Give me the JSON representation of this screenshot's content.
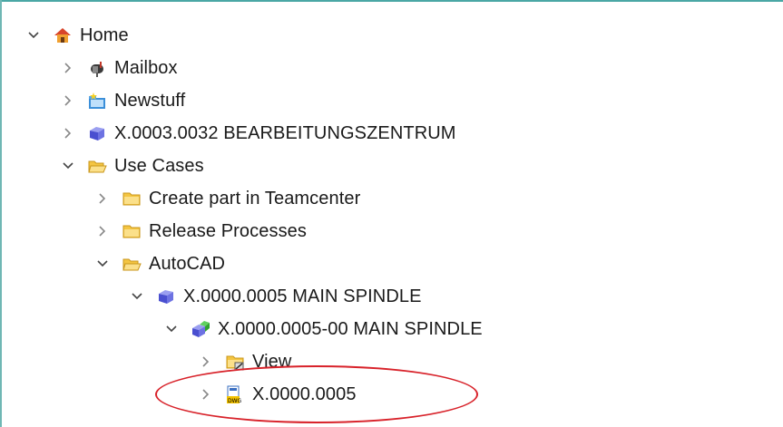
{
  "tree": {
    "items": [
      {
        "label": "Home",
        "icon": "home-icon",
        "expanded": true
      },
      {
        "label": "Mailbox",
        "icon": "mailbox-icon",
        "expanded": false
      },
      {
        "label": "Newstuff",
        "icon": "newstuff-folder-icon",
        "expanded": false
      },
      {
        "label": "X.0003.0032 BEARBEITUNGSZENTRUM",
        "icon": "item-cube-icon",
        "expanded": false
      },
      {
        "label": "Use Cases",
        "icon": "folder-open-icon",
        "expanded": true
      },
      {
        "label": "Create part in Teamcenter",
        "icon": "folder-icon",
        "expanded": false
      },
      {
        "label": "Release Processes",
        "icon": "folder-icon",
        "expanded": false
      },
      {
        "label": "AutoCAD",
        "icon": "folder-open-icon",
        "expanded": true
      },
      {
        "label": "X.0000.0005 MAIN SPINDLE",
        "icon": "item-cube-icon",
        "expanded": true
      },
      {
        "label": "X.0000.0005-00 MAIN SPINDLE",
        "icon": "item-revision-icon",
        "expanded": true
      },
      {
        "label": "View",
        "icon": "view-folder-icon",
        "expanded": false
      },
      {
        "label": "X.0000.0005",
        "icon": "dwg-dataset-icon",
        "expanded": false
      }
    ]
  },
  "colors": {
    "highlight": "#d8222a",
    "border": "#4aa7a5",
    "folder": "#f4c542",
    "cube": "#5b5fd6"
  }
}
